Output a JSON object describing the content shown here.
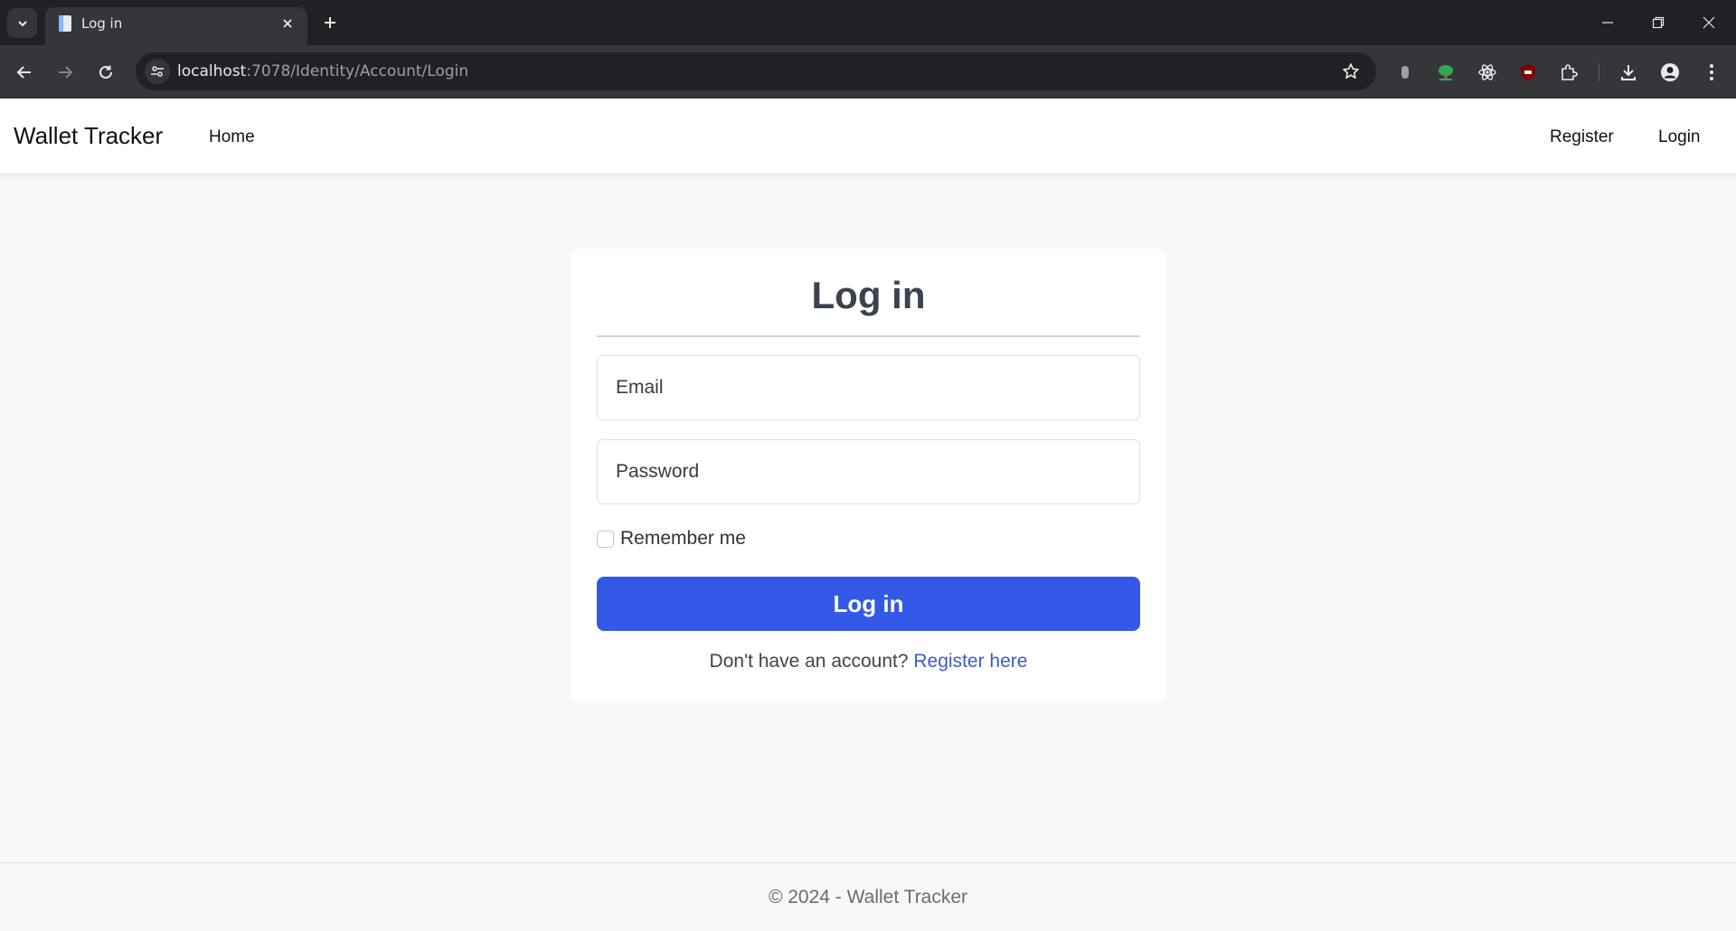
{
  "browser": {
    "tab_title": "Log in",
    "url_host": "localhost",
    "url_rest": ":7078/Identity/Account/Login"
  },
  "navbar": {
    "brand": "Wallet Tracker",
    "home": "Home",
    "register": "Register",
    "login": "Login"
  },
  "login_form": {
    "title": "Log in",
    "email_placeholder": "Email",
    "password_placeholder": "Password",
    "remember_label": "Remember me",
    "remember_checked": false,
    "submit_label": "Log in",
    "signup_prompt": "Don't have an account? ",
    "signup_link": "Register here"
  },
  "footer": {
    "text": "© 2024 - Wallet Tracker"
  },
  "colors": {
    "primary": "#3459e6",
    "link": "#3a5cc6",
    "page_bg": "#f8f8f8"
  }
}
